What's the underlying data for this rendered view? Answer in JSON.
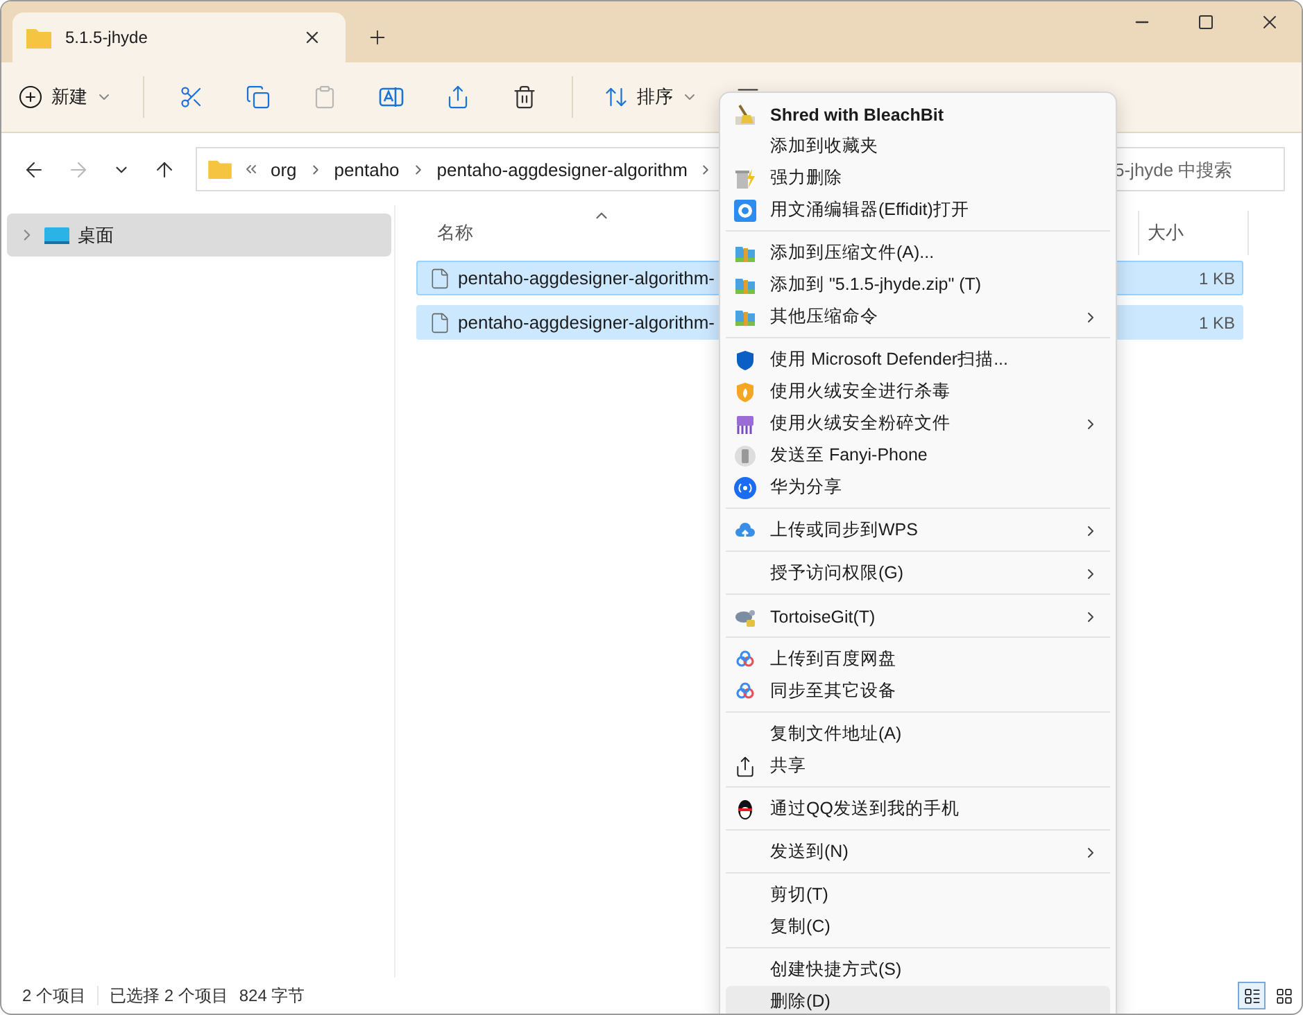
{
  "tabs": [
    {
      "title": "5.1.5-jhyde",
      "selected": true
    }
  ],
  "toolbar": {
    "new_label": "新建",
    "sort_label": "排序",
    "paste_disabled": true
  },
  "address": {
    "crumbs": [
      "org",
      "pentaho",
      "pentaho-aggdesigner-algorithm"
    ]
  },
  "search": {
    "placeholder": "5-jhyde 中搜索"
  },
  "sidebar": {
    "items": [
      {
        "label": "桌面",
        "selected": true
      }
    ]
  },
  "columns": [
    {
      "label": "名称",
      "sorted": true
    },
    {
      "label": "大小",
      "sorted": false
    }
  ],
  "files": [
    {
      "name": "pentaho-aggdesigner-algorithm-",
      "size": "1 KB",
      "selected": true
    },
    {
      "name": "pentaho-aggdesigner-algorithm-",
      "size": "1 KB",
      "selected": true
    }
  ],
  "status_bar": {
    "item_count": "2 个项目",
    "selection": "已选择 2 个项目",
    "size": "824 字节"
  },
  "view_modes": [
    {
      "selected": true
    },
    {
      "selected": false
    }
  ],
  "context_menu": {
    "items": [
      {
        "kind": "item",
        "label": "Shred with BleachBit",
        "bold": true,
        "submenu": false,
        "selected": false
      },
      {
        "kind": "item",
        "label": "添加到收藏夹",
        "submenu": false,
        "selected": false
      },
      {
        "kind": "item",
        "label": "强力删除",
        "submenu": false,
        "selected": false
      },
      {
        "kind": "item",
        "label": "用文涌编辑器(Effidit)打开",
        "submenu": false,
        "selected": false
      },
      {
        "kind": "separator"
      },
      {
        "kind": "item",
        "label": "添加到压缩文件(A)...",
        "submenu": false,
        "selected": false
      },
      {
        "kind": "item",
        "label": "添加到 \"5.1.5-jhyde.zip\" (T)",
        "submenu": false,
        "selected": false
      },
      {
        "kind": "item",
        "label": "其他压缩命令",
        "submenu": true,
        "selected": false
      },
      {
        "kind": "separator"
      },
      {
        "kind": "item",
        "label": "使用 Microsoft Defender扫描...",
        "submenu": false,
        "selected": false
      },
      {
        "kind": "item",
        "label": "使用火绒安全进行杀毒",
        "submenu": false,
        "selected": false
      },
      {
        "kind": "item",
        "label": "使用火绒安全粉碎文件",
        "submenu": true,
        "selected": false
      },
      {
        "kind": "item",
        "label": "发送至 Fanyi-Phone",
        "submenu": false,
        "selected": false
      },
      {
        "kind": "item",
        "label": "华为分享",
        "submenu": false,
        "selected": false
      },
      {
        "kind": "separator"
      },
      {
        "kind": "item",
        "label": "上传或同步到WPS",
        "submenu": true,
        "selected": false
      },
      {
        "kind": "separator"
      },
      {
        "kind": "item",
        "label": "授予访问权限(G)",
        "submenu": true,
        "selected": false
      },
      {
        "kind": "separator"
      },
      {
        "kind": "item",
        "label": "TortoiseGit(T)",
        "submenu": true,
        "selected": false
      },
      {
        "kind": "separator"
      },
      {
        "kind": "item",
        "label": "上传到百度网盘",
        "submenu": false,
        "selected": false
      },
      {
        "kind": "item",
        "label": "同步至其它设备",
        "submenu": false,
        "selected": false
      },
      {
        "kind": "separator"
      },
      {
        "kind": "item",
        "label": "复制文件地址(A)",
        "submenu": false,
        "selected": false
      },
      {
        "kind": "item",
        "label": "共享",
        "submenu": false,
        "selected": false
      },
      {
        "kind": "separator"
      },
      {
        "kind": "item",
        "label": "通过QQ发送到我的手机",
        "submenu": false,
        "selected": false
      },
      {
        "kind": "separator"
      },
      {
        "kind": "item",
        "label": "发送到(N)",
        "submenu": true,
        "selected": false
      },
      {
        "kind": "separator"
      },
      {
        "kind": "item",
        "label": "剪切(T)",
        "submenu": false,
        "selected": false
      },
      {
        "kind": "item",
        "label": "复制(C)",
        "submenu": false,
        "selected": false
      },
      {
        "kind": "separator"
      },
      {
        "kind": "item",
        "label": "创建快捷方式(S)",
        "submenu": false,
        "selected": false
      },
      {
        "kind": "item",
        "label": "删除(D)",
        "submenu": false,
        "selected": true
      }
    ]
  }
}
